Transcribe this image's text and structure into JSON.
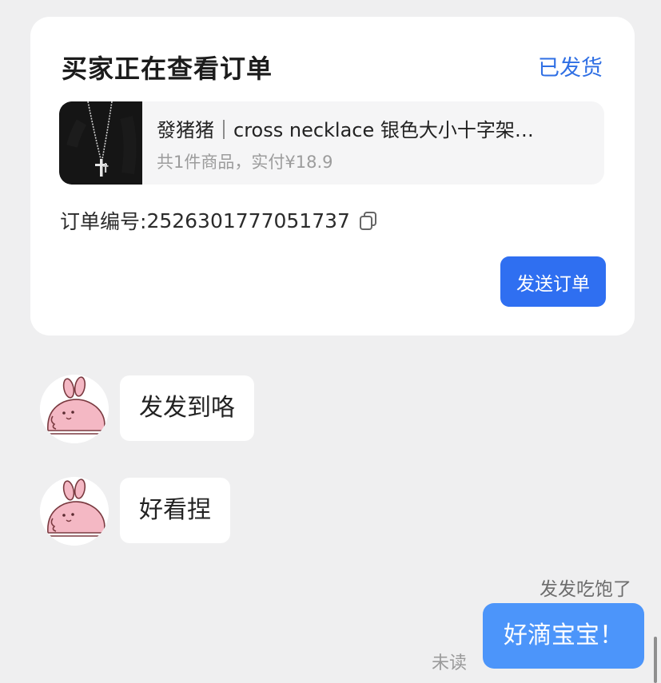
{
  "order_card": {
    "title": "买家正在查看订单",
    "status": "已发货",
    "product": {
      "name": "發猪猪｜cross necklace 银色大小十字架…",
      "meta": "共1件商品，实付¥18.9",
      "thumbnail": "cross-necklace-photo"
    },
    "order_number_label": "订单编号: ",
    "order_number": "2526301777051737",
    "copy_icon": "copy-icon",
    "send_button": "发送订单",
    "colors": {
      "accent": "#2f6ff1",
      "status": "#2f6fe4"
    }
  },
  "messages": [
    {
      "direction": "incoming",
      "text": "发发到咯",
      "avatar": "pink-rabbit-avatar"
    },
    {
      "direction": "incoming",
      "text": "好看捏",
      "avatar": "pink-rabbit-avatar"
    },
    {
      "direction": "outgoing",
      "sender": "发发吃饱了",
      "text": "好滴宝宝！",
      "read_status": "未读"
    }
  ],
  "colors": {
    "background": "#efeff0",
    "outgoing_bubble": "#4c95fa",
    "incoming_bubble": "#ffffff"
  }
}
